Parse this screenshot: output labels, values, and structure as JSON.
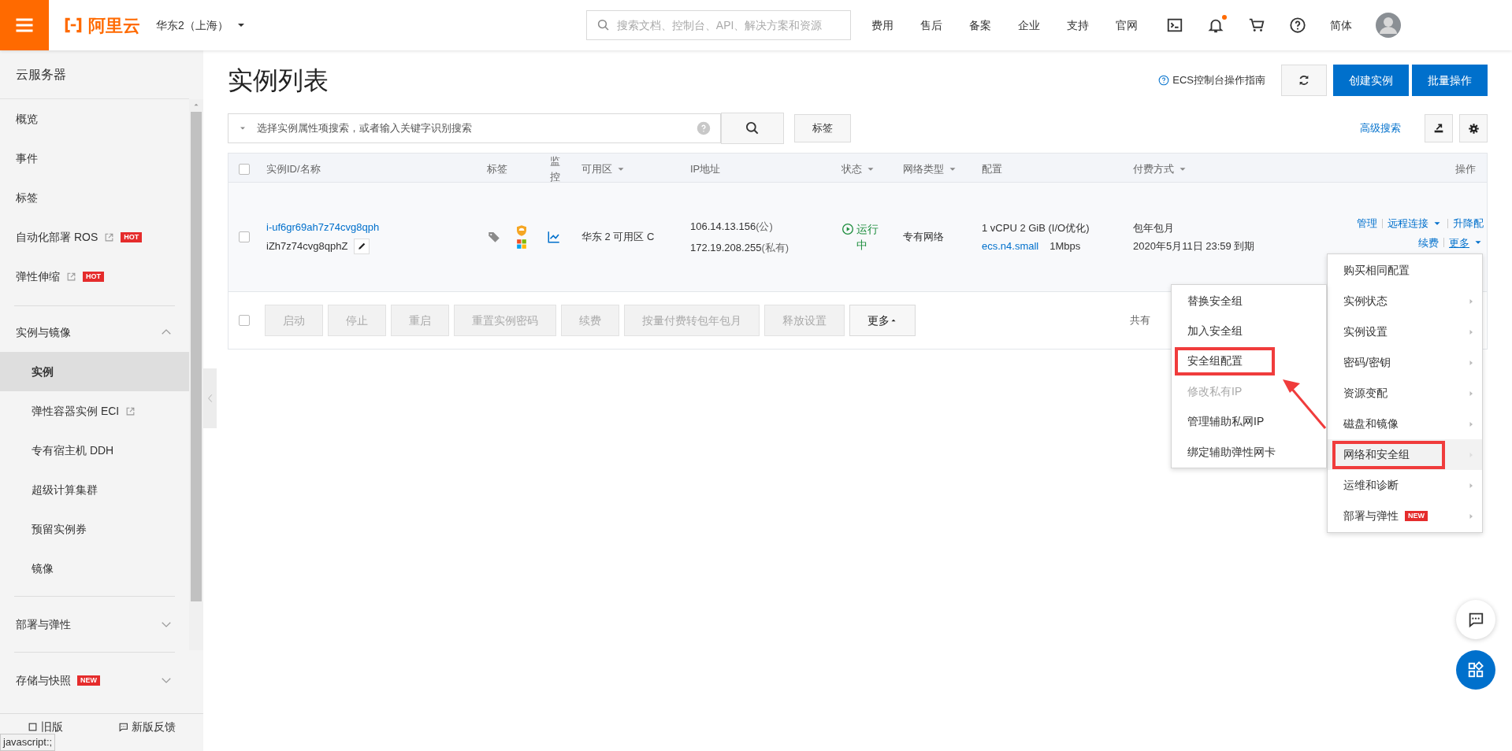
{
  "header": {
    "logo_text": "阿里云",
    "region": "华东2（上海）",
    "search_placeholder": "搜索文档、控制台、API、解决方案和资源",
    "nav": [
      "费用",
      "售后",
      "备案",
      "企业",
      "支持",
      "官网"
    ],
    "notification_dot": true,
    "language": "简体"
  },
  "sidebar": {
    "title": "云服务器",
    "items": [
      {
        "kind": "item",
        "label": "概览",
        "selected": false
      },
      {
        "kind": "item",
        "label": "事件",
        "selected": false
      },
      {
        "kind": "item",
        "label": "标签",
        "selected": false
      },
      {
        "kind": "item",
        "label": "自动化部署 ROS",
        "external": true,
        "badge": "HOT",
        "selected": false
      },
      {
        "kind": "item",
        "label": "弹性伸缩",
        "external": true,
        "badge": "HOT",
        "selected": false
      },
      {
        "kind": "group",
        "label": "实例与镜像",
        "expanded": true,
        "children": [
          {
            "label": "实例",
            "selected": true
          },
          {
            "label": "弹性容器实例 ECI",
            "external": true,
            "selected": false
          },
          {
            "label": "专有宿主机 DDH",
            "selected": false
          },
          {
            "label": "超级计算集群",
            "selected": false
          },
          {
            "label": "预留实例券",
            "selected": false
          },
          {
            "label": "镜像",
            "selected": false
          }
        ]
      },
      {
        "kind": "group",
        "label": "部署与弹性",
        "expanded": false
      },
      {
        "kind": "group",
        "label": "存储与快照",
        "expanded": false,
        "badge": "NEW"
      }
    ],
    "footer": [
      "旧版",
      "新版反馈"
    ]
  },
  "status_tooltip": "javascript:;",
  "page": {
    "title": "实例列表",
    "guide_link": "ECS控制台操作指南",
    "buttons": [
      "创建实例",
      "批量操作"
    ]
  },
  "search": {
    "placeholder": "选择实例属性项搜索，或者输入关键字识别搜索",
    "tag_button": "标签",
    "advanced": "高级搜索"
  },
  "table": {
    "columns": [
      {
        "label": "实例ID/名称",
        "sortable": false
      },
      {
        "label": "标签",
        "sortable": false
      },
      {
        "label": "监控",
        "sortable": false
      },
      {
        "label": "可用区",
        "sortable": true
      },
      {
        "label": "IP地址",
        "sortable": false
      },
      {
        "label": "状态",
        "sortable": true
      },
      {
        "label": "网络类型",
        "sortable": true
      },
      {
        "label": "配置",
        "sortable": false
      },
      {
        "label": "付费方式",
        "sortable": true
      },
      {
        "label": "操作",
        "sortable": false
      }
    ],
    "rows": [
      {
        "checked": false,
        "id": "i-uf6gr69ah7z74cvg8qph",
        "name": "iZh7z74cvg8qphZ",
        "zone": "华东 2 可用区 C",
        "public_ip": "106.14.13.156",
        "public_suffix": "(公)",
        "private_ip": "172.19.208.255",
        "private_suffix": "(私有)",
        "status": "运行中",
        "network": "专有网络",
        "spec": "1 vCPU 2 GiB (I/O优化)",
        "instance_type": "ecs.n4.small",
        "bandwidth": "1Mbps",
        "billing": "包年包月",
        "expiry": "2020年5月11日 23:59 到期",
        "actions": [
          [
            "管理",
            "远程连接",
            "升降配"
          ],
          [
            "续费",
            "更多"
          ]
        ]
      }
    ],
    "header_checked": false,
    "footer_checked": false,
    "footer_buttons": [
      {
        "label": "启动",
        "disabled": true
      },
      {
        "label": "停止",
        "disabled": true
      },
      {
        "label": "重启",
        "disabled": true
      },
      {
        "label": "重置实例密码",
        "disabled": true
      },
      {
        "label": "续费",
        "disabled": true
      },
      {
        "label": "按量付费转包年包月",
        "disabled": true
      },
      {
        "label": "释放设置",
        "disabled": true
      },
      {
        "label": "更多",
        "disabled": false
      }
    ],
    "total": "共有"
  },
  "more_menu": [
    {
      "label": "购买相同配置",
      "submenu": false,
      "selected": false,
      "highlighted": false
    },
    {
      "label": "实例状态",
      "submenu": true,
      "selected": false,
      "highlighted": false
    },
    {
      "label": "实例设置",
      "submenu": true,
      "selected": false,
      "highlighted": false
    },
    {
      "label": "密码/密钥",
      "submenu": true,
      "selected": false,
      "highlighted": false
    },
    {
      "label": "资源变配",
      "submenu": true,
      "selected": false,
      "highlighted": false
    },
    {
      "label": "磁盘和镜像",
      "submenu": true,
      "selected": false,
      "highlighted": false
    },
    {
      "label": "网络和安全组",
      "submenu": true,
      "selected": true,
      "highlighted": true
    },
    {
      "label": "运维和诊断",
      "submenu": true,
      "selected": false,
      "highlighted": false
    },
    {
      "label": "部署与弹性",
      "submenu": true,
      "selected": false,
      "highlighted": false,
      "badge": "NEW"
    }
  ],
  "submenu": [
    {
      "label": "替换安全组",
      "disabled": false,
      "highlighted": false
    },
    {
      "label": "加入安全组",
      "disabled": false,
      "highlighted": false
    },
    {
      "label": "安全组配置",
      "disabled": false,
      "highlighted": true
    },
    {
      "label": "修改私有IP",
      "disabled": true,
      "highlighted": false
    },
    {
      "label": "管理辅助私网IP",
      "disabled": false,
      "highlighted": false
    },
    {
      "label": "绑定辅助弹性网卡",
      "disabled": false,
      "highlighted": false
    }
  ]
}
